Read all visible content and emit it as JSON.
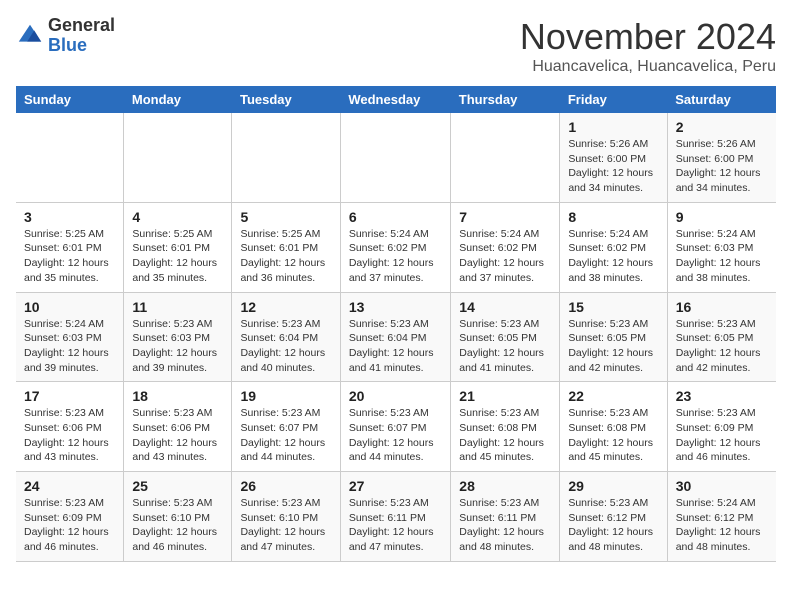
{
  "header": {
    "logo_general": "General",
    "logo_blue": "Blue",
    "month_title": "November 2024",
    "location": "Huancavelica, Huancavelica, Peru"
  },
  "calendar": {
    "days_of_week": [
      "Sunday",
      "Monday",
      "Tuesday",
      "Wednesday",
      "Thursday",
      "Friday",
      "Saturday"
    ],
    "weeks": [
      [
        {
          "day": "",
          "info": ""
        },
        {
          "day": "",
          "info": ""
        },
        {
          "day": "",
          "info": ""
        },
        {
          "day": "",
          "info": ""
        },
        {
          "day": "",
          "info": ""
        },
        {
          "day": "1",
          "info": "Sunrise: 5:26 AM\nSunset: 6:00 PM\nDaylight: 12 hours and 34 minutes."
        },
        {
          "day": "2",
          "info": "Sunrise: 5:26 AM\nSunset: 6:00 PM\nDaylight: 12 hours and 34 minutes."
        }
      ],
      [
        {
          "day": "3",
          "info": "Sunrise: 5:25 AM\nSunset: 6:01 PM\nDaylight: 12 hours and 35 minutes."
        },
        {
          "day": "4",
          "info": "Sunrise: 5:25 AM\nSunset: 6:01 PM\nDaylight: 12 hours and 35 minutes."
        },
        {
          "day": "5",
          "info": "Sunrise: 5:25 AM\nSunset: 6:01 PM\nDaylight: 12 hours and 36 minutes."
        },
        {
          "day": "6",
          "info": "Sunrise: 5:24 AM\nSunset: 6:02 PM\nDaylight: 12 hours and 37 minutes."
        },
        {
          "day": "7",
          "info": "Sunrise: 5:24 AM\nSunset: 6:02 PM\nDaylight: 12 hours and 37 minutes."
        },
        {
          "day": "8",
          "info": "Sunrise: 5:24 AM\nSunset: 6:02 PM\nDaylight: 12 hours and 38 minutes."
        },
        {
          "day": "9",
          "info": "Sunrise: 5:24 AM\nSunset: 6:03 PM\nDaylight: 12 hours and 38 minutes."
        }
      ],
      [
        {
          "day": "10",
          "info": "Sunrise: 5:24 AM\nSunset: 6:03 PM\nDaylight: 12 hours and 39 minutes."
        },
        {
          "day": "11",
          "info": "Sunrise: 5:23 AM\nSunset: 6:03 PM\nDaylight: 12 hours and 39 minutes."
        },
        {
          "day": "12",
          "info": "Sunrise: 5:23 AM\nSunset: 6:04 PM\nDaylight: 12 hours and 40 minutes."
        },
        {
          "day": "13",
          "info": "Sunrise: 5:23 AM\nSunset: 6:04 PM\nDaylight: 12 hours and 41 minutes."
        },
        {
          "day": "14",
          "info": "Sunrise: 5:23 AM\nSunset: 6:05 PM\nDaylight: 12 hours and 41 minutes."
        },
        {
          "day": "15",
          "info": "Sunrise: 5:23 AM\nSunset: 6:05 PM\nDaylight: 12 hours and 42 minutes."
        },
        {
          "day": "16",
          "info": "Sunrise: 5:23 AM\nSunset: 6:05 PM\nDaylight: 12 hours and 42 minutes."
        }
      ],
      [
        {
          "day": "17",
          "info": "Sunrise: 5:23 AM\nSunset: 6:06 PM\nDaylight: 12 hours and 43 minutes."
        },
        {
          "day": "18",
          "info": "Sunrise: 5:23 AM\nSunset: 6:06 PM\nDaylight: 12 hours and 43 minutes."
        },
        {
          "day": "19",
          "info": "Sunrise: 5:23 AM\nSunset: 6:07 PM\nDaylight: 12 hours and 44 minutes."
        },
        {
          "day": "20",
          "info": "Sunrise: 5:23 AM\nSunset: 6:07 PM\nDaylight: 12 hours and 44 minutes."
        },
        {
          "day": "21",
          "info": "Sunrise: 5:23 AM\nSunset: 6:08 PM\nDaylight: 12 hours and 45 minutes."
        },
        {
          "day": "22",
          "info": "Sunrise: 5:23 AM\nSunset: 6:08 PM\nDaylight: 12 hours and 45 minutes."
        },
        {
          "day": "23",
          "info": "Sunrise: 5:23 AM\nSunset: 6:09 PM\nDaylight: 12 hours and 46 minutes."
        }
      ],
      [
        {
          "day": "24",
          "info": "Sunrise: 5:23 AM\nSunset: 6:09 PM\nDaylight: 12 hours and 46 minutes."
        },
        {
          "day": "25",
          "info": "Sunrise: 5:23 AM\nSunset: 6:10 PM\nDaylight: 12 hours and 46 minutes."
        },
        {
          "day": "26",
          "info": "Sunrise: 5:23 AM\nSunset: 6:10 PM\nDaylight: 12 hours and 47 minutes."
        },
        {
          "day": "27",
          "info": "Sunrise: 5:23 AM\nSunset: 6:11 PM\nDaylight: 12 hours and 47 minutes."
        },
        {
          "day": "28",
          "info": "Sunrise: 5:23 AM\nSunset: 6:11 PM\nDaylight: 12 hours and 48 minutes."
        },
        {
          "day": "29",
          "info": "Sunrise: 5:23 AM\nSunset: 6:12 PM\nDaylight: 12 hours and 48 minutes."
        },
        {
          "day": "30",
          "info": "Sunrise: 5:24 AM\nSunset: 6:12 PM\nDaylight: 12 hours and 48 minutes."
        }
      ]
    ]
  }
}
